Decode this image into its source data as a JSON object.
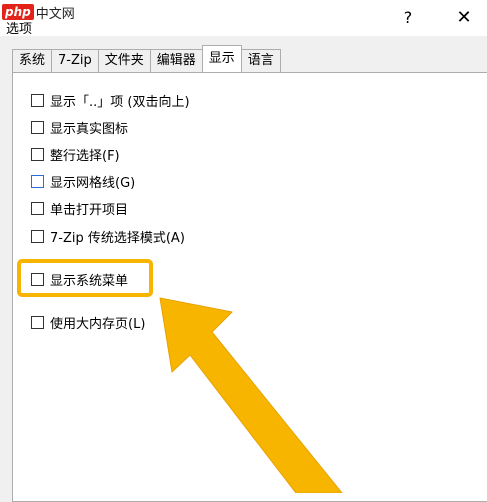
{
  "watermark": {
    "logo": "php",
    "text": "中文网"
  },
  "window": {
    "title": "选项",
    "help_label": "?",
    "close_label": "✕"
  },
  "tabs": [
    {
      "label": "系统"
    },
    {
      "label": "7-Zip"
    },
    {
      "label": "文件夹"
    },
    {
      "label": "编辑器"
    },
    {
      "label": "显示",
      "active": true
    },
    {
      "label": "语言"
    }
  ],
  "options": [
    {
      "label": "显示「..」项 (双击向上)",
      "checked": false
    },
    {
      "label": "显示真实图标",
      "checked": false
    },
    {
      "label": "整行选择(F)",
      "checked": false
    },
    {
      "label": "显示网格线(G)",
      "checked": false
    },
    {
      "label": "单击打开项目",
      "checked": false
    },
    {
      "label": "7-Zip 传统选择模式(A)",
      "checked": false
    },
    {
      "label": "显示系统菜单",
      "checked": false
    },
    {
      "label": "使用大内存页(L)",
      "checked": false
    }
  ],
  "highlight_color": "#f7b500"
}
